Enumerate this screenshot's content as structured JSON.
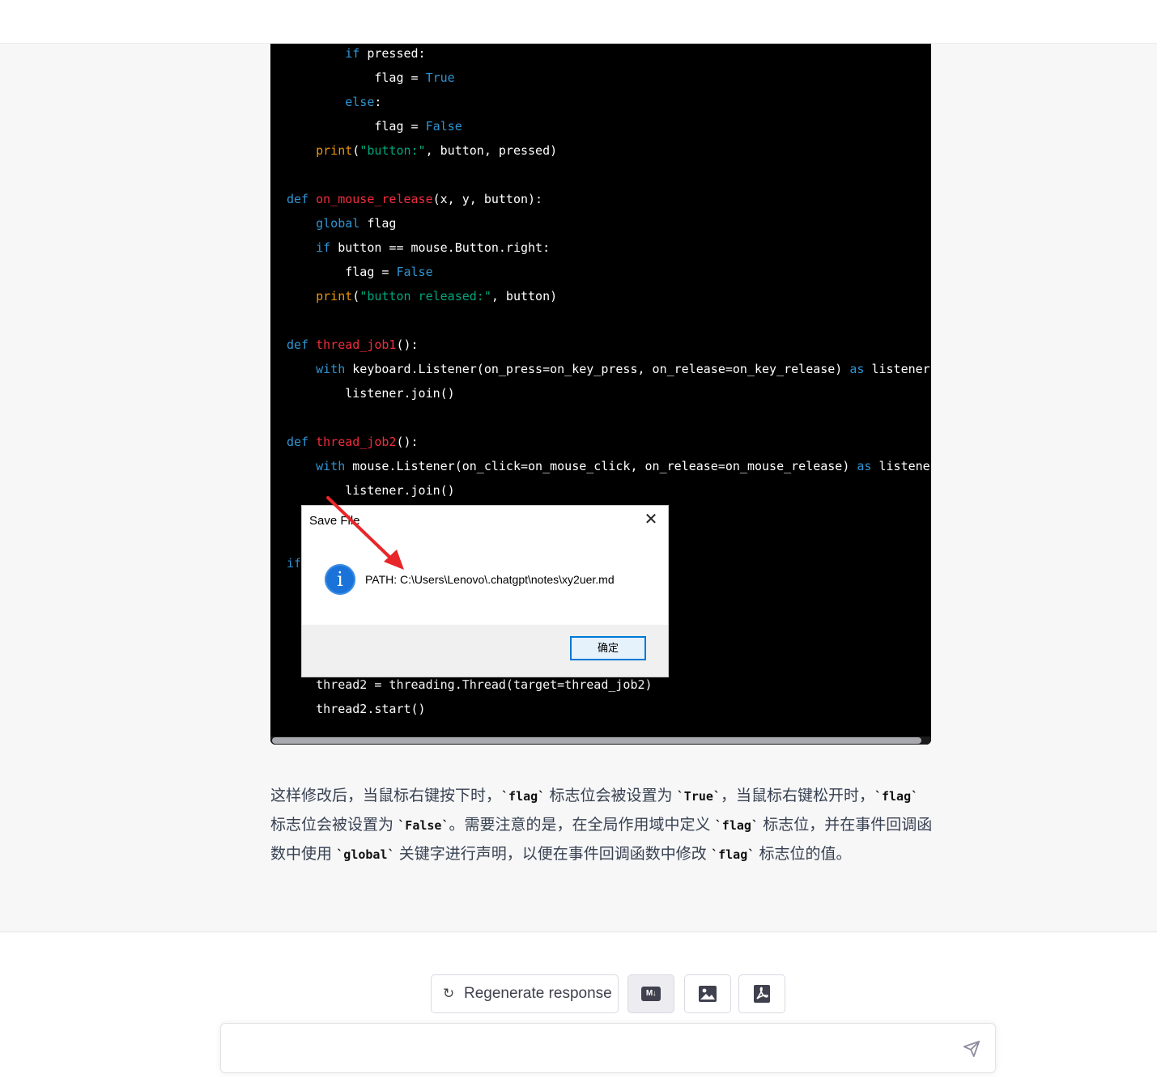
{
  "code": {
    "lines": [
      [
        {
          "t": "        "
        },
        {
          "t": "if",
          "c": "kw"
        },
        {
          "t": " pressed:"
        }
      ],
      [
        {
          "t": "            flag = "
        },
        {
          "t": "True",
          "c": "kw"
        }
      ],
      [
        {
          "t": "        "
        },
        {
          "t": "else",
          "c": "kw"
        },
        {
          "t": ":"
        }
      ],
      [
        {
          "t": "            flag = "
        },
        {
          "t": "False",
          "c": "kw"
        }
      ],
      [
        {
          "t": "    "
        },
        {
          "t": "print",
          "c": "bi"
        },
        {
          "t": "("
        },
        {
          "t": "\"button:\"",
          "c": "st"
        },
        {
          "t": ", button, pressed)"
        }
      ],
      [
        {
          "t": ""
        }
      ],
      [
        {
          "t": "def",
          "c": "kw"
        },
        {
          "t": " "
        },
        {
          "t": "on_mouse_release",
          "c": "fn"
        },
        {
          "t": "(x, y, button):"
        }
      ],
      [
        {
          "t": "    "
        },
        {
          "t": "global",
          "c": "kw"
        },
        {
          "t": " flag"
        }
      ],
      [
        {
          "t": "    "
        },
        {
          "t": "if",
          "c": "kw"
        },
        {
          "t": " button == mouse.Button.right:"
        }
      ],
      [
        {
          "t": "        flag = "
        },
        {
          "t": "False",
          "c": "kw"
        }
      ],
      [
        {
          "t": "    "
        },
        {
          "t": "print",
          "c": "bi"
        },
        {
          "t": "("
        },
        {
          "t": "\"button released:\"",
          "c": "st"
        },
        {
          "t": ", button)"
        }
      ],
      [
        {
          "t": ""
        }
      ],
      [
        {
          "t": "def",
          "c": "kw"
        },
        {
          "t": " "
        },
        {
          "t": "thread_job1",
          "c": "fn"
        },
        {
          "t": "():"
        }
      ],
      [
        {
          "t": "    "
        },
        {
          "t": "with",
          "c": "kw"
        },
        {
          "t": " keyboard.Listener(on_press=on_key_press, on_release=on_key_release) "
        },
        {
          "t": "as",
          "c": "kw"
        },
        {
          "t": " listener:"
        }
      ],
      [
        {
          "t": "        listener.join()"
        }
      ],
      [
        {
          "t": ""
        }
      ],
      [
        {
          "t": "def",
          "c": "kw"
        },
        {
          "t": " "
        },
        {
          "t": "thread_job2",
          "c": "fn"
        },
        {
          "t": "():"
        }
      ],
      [
        {
          "t": "    "
        },
        {
          "t": "with",
          "c": "kw"
        },
        {
          "t": " mouse.Listener(on_click=on_mouse_click, on_release=on_mouse_release) "
        },
        {
          "t": "as",
          "c": "kw"
        },
        {
          "t": " listener:"
        }
      ],
      [
        {
          "t": "        listener.join()"
        }
      ],
      [
        {
          "t": ""
        }
      ],
      [
        {
          "t": ""
        }
      ],
      [
        {
          "t": "if",
          "c": "kw"
        }
      ],
      [
        {
          "t": ""
        }
      ],
      [
        {
          "t": ""
        }
      ],
      [
        {
          "t": ""
        }
      ],
      [
        {
          "t": ""
        }
      ],
      [
        {
          "t": "    thread2 = threading.Thread(target=thread_job2)"
        }
      ],
      [
        {
          "t": "    thread2.start()"
        }
      ]
    ]
  },
  "dialog": {
    "title": "Save File",
    "message": "PATH: C:\\Users\\Lenovo\\.chatgpt\\notes\\xy2uer.md",
    "ok_label": "确定",
    "close_glyph": "✕",
    "info_glyph": "i"
  },
  "paragraph": [
    {
      "t": "这样修改后，当鼠标右键按下时，"
    },
    {
      "c": "`flag`"
    },
    {
      "t": " 标志位会被设置为 "
    },
    {
      "c": "`True`"
    },
    {
      "t": "，当鼠标右键松开时，"
    },
    {
      "c": "`flag`"
    },
    {
      "t": " 标志位会被设置为 "
    },
    {
      "c": "`False`"
    },
    {
      "t": "。需要注意的是，在全局作用域中定义 "
    },
    {
      "c": "`flag`"
    },
    {
      "t": " 标志位，并在事件回调函数中使用 "
    },
    {
      "c": "`global`"
    },
    {
      "t": " 关键字进行声明，以便在事件回调函数中修改 "
    },
    {
      "c": "`flag`"
    },
    {
      "t": " 标志位的值。"
    }
  ],
  "actions": {
    "regenerate_label": "Regenerate response",
    "regenerate_icon": "refresh-icon",
    "markdown_icon_text": "M↓",
    "markdown_icon": "markdown-icon",
    "image_icon": "image-icon",
    "pdf_icon": "pdf-icon"
  },
  "chat_input": {
    "value": "",
    "placeholder": ""
  },
  "colors": {
    "accent_red": "#e8262a",
    "dialog_blue": "#0078d7",
    "keyword": "#2e95d3",
    "function": "#f22c3d",
    "string": "#00a67d",
    "builtin": "#e9950c"
  }
}
